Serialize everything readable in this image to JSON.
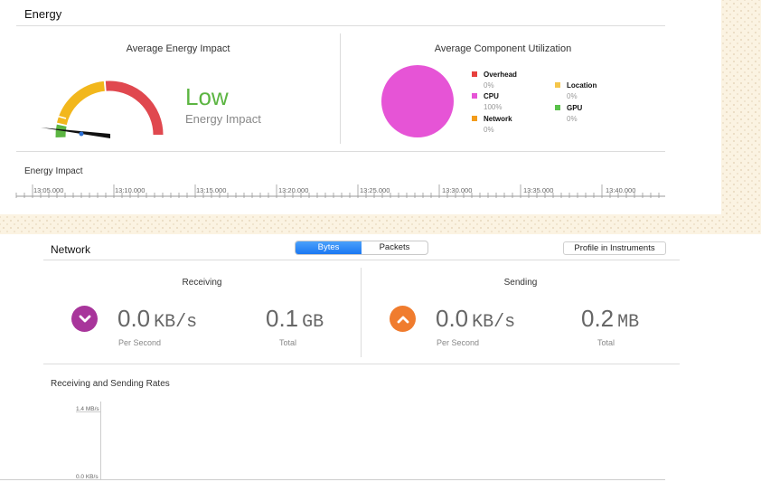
{
  "energy": {
    "title": "Energy",
    "avg_impact": {
      "title": "Average Energy Impact",
      "status": "Low",
      "subtitle": "Energy Impact",
      "gauge_colors": {
        "low": "#5cb542",
        "mid": "#f2b71c",
        "high": "#e0484f"
      },
      "needle_level": 0.05
    },
    "utilization": {
      "title": "Average Component Utilization",
      "legend": [
        {
          "name": "Overhead",
          "value": "0%",
          "color": "#e7403d"
        },
        {
          "name": "CPU",
          "value": "100%",
          "color": "#e654d6"
        },
        {
          "name": "Network",
          "value": "0%",
          "color": "#f39c1a"
        },
        {
          "name": "Location",
          "value": "0%",
          "color": "#f5c64a"
        },
        {
          "name": "GPU",
          "value": "0%",
          "color": "#59c14a"
        }
      ]
    },
    "timeline": {
      "label": "Energy Impact",
      "ticks": [
        "13:05.000",
        "13:10.000",
        "13:15.000",
        "13:20.000",
        "13:25.000",
        "13:30.000",
        "13:35.000",
        "13:40.000"
      ]
    }
  },
  "network": {
    "title": "Network",
    "segments": [
      "Bytes",
      "Packets"
    ],
    "selected_segment": "Bytes",
    "profile_button": "Profile in Instruments",
    "receiving": {
      "title": "Receiving",
      "rate_value": "0.0",
      "rate_unit": "KB/s",
      "rate_label": "Per Second",
      "total_value": "0.1",
      "total_unit": "GB",
      "total_label": "Total",
      "icon": "chevron-down-icon",
      "color": "#a8359b"
    },
    "sending": {
      "title": "Sending",
      "rate_value": "0.0",
      "rate_unit": "KB/s",
      "rate_label": "Per Second",
      "total_value": "0.2",
      "total_unit": "MB",
      "total_label": "Total",
      "icon": "chevron-up-icon",
      "color": "#f07c2e"
    },
    "rates_chart": {
      "title": "Receiving and Sending Rates",
      "y_max_label": "1.4 MB/s",
      "y_min_label": "0.0 KB/s"
    }
  }
}
